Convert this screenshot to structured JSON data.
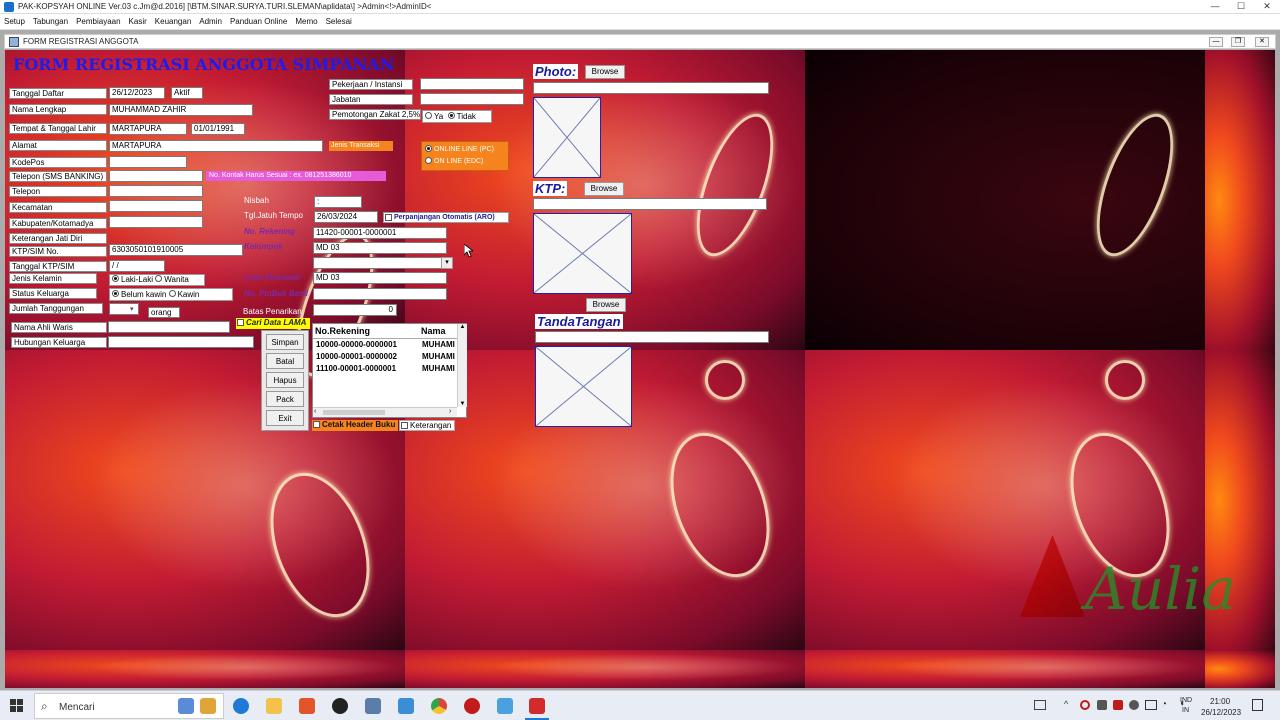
{
  "window": {
    "title": "PAK-KOPSYAH ONLINE Ver.03 c.Jm@d.2016] [\\BTM.SINAR.SURYA.TURI.SLEMAN\\aplidata\\] >Admin<!>AdminID<",
    "minimize": "—",
    "maximize": "☐",
    "close": "✕"
  },
  "menu": [
    "Setup",
    "Tabungan",
    "Pembiayaan",
    "Kasir",
    "Keuangan",
    "Admin",
    "Panduan Online",
    "Memo",
    "Selesai"
  ],
  "child_window": {
    "title": "FORM REGISTRASI ANGGOTA",
    "minimize": "—",
    "maximize": "❐",
    "close": "✕"
  },
  "form": {
    "heading": "FORM REGISTRASI ANGGOTA SIMPANAN",
    "tanggal_daftar": {
      "label": "Tanggal Daftar",
      "value": "26/12/2023",
      "status": "Aktif"
    },
    "nama_lengkap": {
      "label": "Nama Lengkap",
      "value": "MUHAMMAD ZAHIR"
    },
    "ttl": {
      "label": "Tempat & Tanggal Lahir",
      "tempat": "MARTAPURA",
      "tanggal": "01/01/1991"
    },
    "alamat": {
      "label": "Alamat",
      "value": "MARTAPURA"
    },
    "jenis_transaksi": "Jenis Transaksi",
    "kodepos": {
      "label": "KodePos",
      "value": ""
    },
    "telepon_sms": {
      "label": "Telepon (SMS BANKING)",
      "value": "",
      "hint": "No. Kontak Harus Sesuai : ex. 081251386010"
    },
    "telepon": {
      "label": "Telepon",
      "value": ""
    },
    "kecamatan": {
      "label": "Kecamatan",
      "value": ""
    },
    "kabupaten": {
      "label": "Kabupaten/Kotamadya",
      "value": ""
    },
    "ket_jati_diri": {
      "label": "Keterangan Jati Diri"
    },
    "ktp_no": {
      "label": "KTP/SIM No.",
      "value": "6303050101910005"
    },
    "tgl_ktp": {
      "label": "Tanggal KTP/SIM",
      "value": " / /"
    },
    "jenis_kelamin": {
      "label": "Jenis Kelamin",
      "options": [
        "Laki-Laki",
        "Wanita"
      ],
      "selected": "Laki-Laki"
    },
    "status_keluarga": {
      "label": "Status Keluarga",
      "options": [
        "Belum kawin",
        "Kawin"
      ],
      "selected": "Belum kawin"
    },
    "jumlah_tanggungan": {
      "label": "Jumlah Tanggungan",
      "value": "",
      "unit": "orang"
    },
    "ahli_waris": {
      "label": "Nama Ahli Waris",
      "value": ""
    },
    "hubungan": {
      "label": "Hubungan Keluarga",
      "value": ""
    },
    "pekerjaan": {
      "label": "Pekerjaan / Instansi",
      "value": ""
    },
    "jabatan": {
      "label": "Jabatan",
      "value": ""
    },
    "zakat": {
      "label": "Pemotongan Zakat 2,5%",
      "options": [
        "Ya",
        "Tidak"
      ],
      "selected": "Tidak"
    },
    "online": {
      "options": [
        "ONLINE LINE (PC)",
        "ON LINE (EDC)"
      ],
      "selected": "ONLINE LINE (PC)"
    },
    "nisbah": {
      "label": "Nisbah",
      "value": ":"
    },
    "jatuh_tempo": {
      "label": "Tgl.Jatuh Tempo",
      "value": "26/03/2024"
    },
    "aro": "Perpanjangan Otomatis (ARO)",
    "no_rekening": {
      "label": "No. Rekening",
      "value": "11420-00001-0000001"
    },
    "kelompok": {
      "label": "Kelompok",
      "value": "MD 03"
    },
    "loan_promoter": {
      "label": "Loan Promoter",
      "value": "MD 03"
    },
    "no_pinbuk": {
      "label": "No. PinBuk Basil",
      "value": ""
    },
    "batas_penarikan": {
      "label": "Batas Penarikan",
      "value": "0"
    },
    "cari_data_lama": "Cari Data LAMA",
    "buttons": [
      "Simpan",
      "Batal",
      "Hapus",
      "Pack",
      "Exit"
    ],
    "rek_table": {
      "columns": [
        "No.Rekening",
        "Nama"
      ],
      "rows": [
        [
          "10000-00000-0000001",
          "MUHAMI"
        ],
        [
          "10000-00001-0000002",
          "MUHAMI"
        ],
        [
          "11100-00001-0000001",
          "MUHAMI"
        ]
      ]
    },
    "cetak_header": "Cetak Header Buku",
    "keterangan": "Keterangan",
    "photo": {
      "label": "Photo:",
      "browse": "Browse"
    },
    "ktp": {
      "label": "KTP:",
      "browse": "Browse"
    },
    "ttd": {
      "label": "TandaTangan",
      "browse": "Browse"
    }
  },
  "taskbar": {
    "search": "Mencari",
    "lang": "IND",
    "lang2": "IN",
    "time": "21:00",
    "date": "26/12/2023"
  },
  "colors": {
    "heading": "#1c1cf0",
    "purple_label": "#7a2aa8",
    "orange": "#f5841f",
    "pink_hint": "#e65bd8",
    "yellow": "#ffff00"
  }
}
